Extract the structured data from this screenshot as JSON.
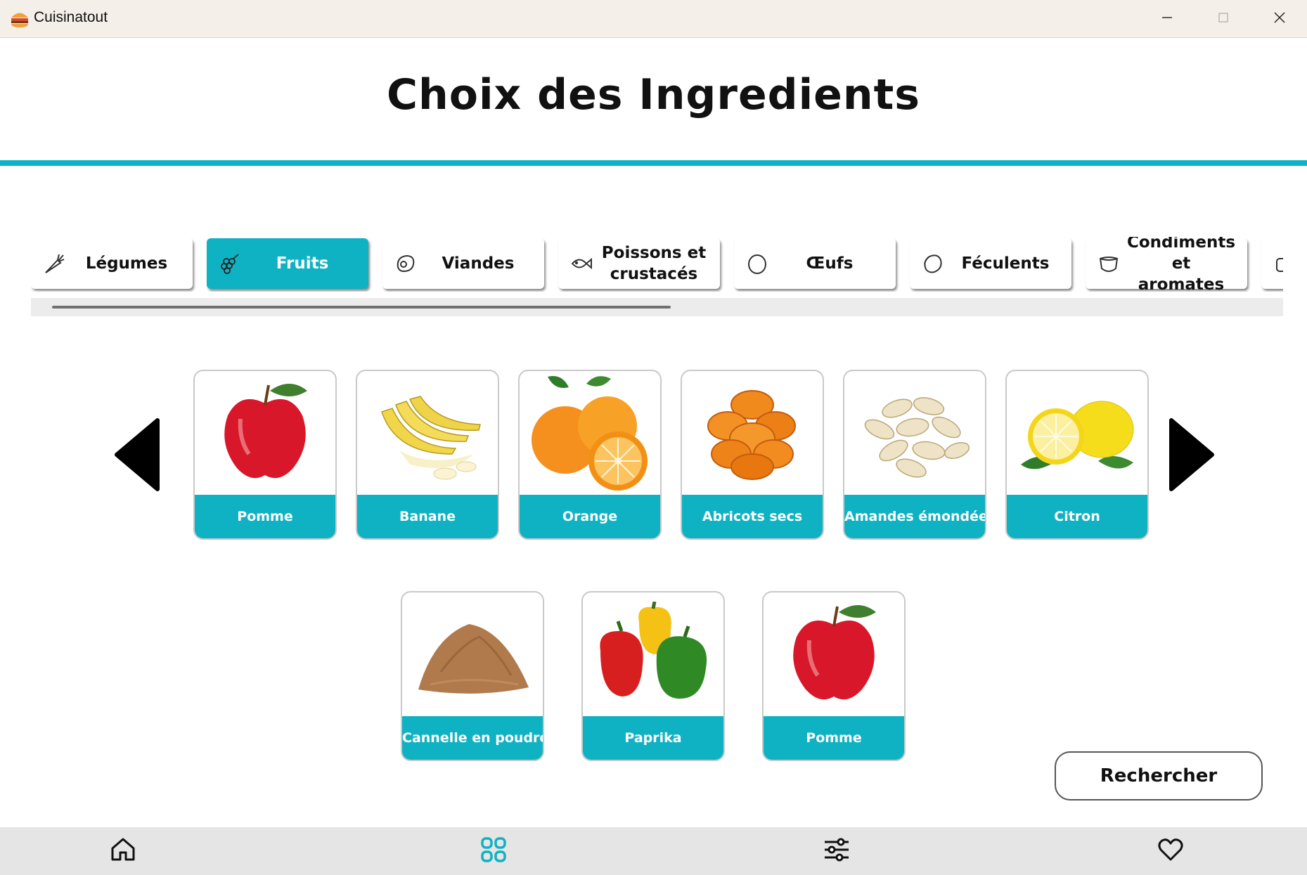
{
  "window": {
    "title": "Cuisinatout",
    "app_icon": "burger-icon",
    "controls": [
      "minimize-icon",
      "maximize-icon",
      "close-icon"
    ]
  },
  "header": {
    "title": "Choix des Ingredients",
    "accent_color": "#0fb2c3"
  },
  "categories": [
    {
      "label": "Légumes",
      "icon": "carrot-icon",
      "active": false
    },
    {
      "label": "Fruits",
      "icon": "grapes-icon",
      "active": true
    },
    {
      "label": "Viandes",
      "icon": "meat-icon",
      "active": false
    },
    {
      "label": "Poissons et\ncrustacés",
      "icon": "fish-icon",
      "active": false
    },
    {
      "label": "Œufs",
      "icon": "egg-icon",
      "active": false
    },
    {
      "label": "Féculents",
      "icon": "potato-icon",
      "active": false
    },
    {
      "label": "Condiments et\naromates",
      "icon": "bowl-icon",
      "active": false
    }
  ],
  "ingredients_row1": [
    {
      "label": "Pomme",
      "image": "apple"
    },
    {
      "label": "Banane",
      "image": "banana"
    },
    {
      "label": "Orange",
      "image": "orange"
    },
    {
      "label": "Abricots secs",
      "image": "dried-apricots"
    },
    {
      "label": "Amandes émondées",
      "image": "blanched-almonds"
    },
    {
      "label": "Citron",
      "image": "lemon"
    }
  ],
  "ingredients_row2": [
    {
      "label": "Cannelle en poudre",
      "image": "cinnamon-powder"
    },
    {
      "label": "Paprika",
      "image": "bell-peppers"
    },
    {
      "label": "Pomme",
      "image": "apple"
    }
  ],
  "actions": {
    "search_label": "Rechercher",
    "prev": "arrow-left-icon",
    "next": "arrow-right-icon"
  },
  "bottom_nav": [
    "home-icon",
    "grid-icon",
    "sliders-icon",
    "heart-icon"
  ]
}
